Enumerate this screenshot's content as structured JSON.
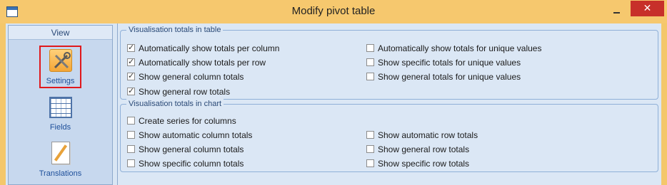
{
  "window": {
    "title": "Modify pivot table",
    "close_glyph": "✕"
  },
  "sidebar": {
    "header": "View",
    "items": [
      {
        "label": "Settings",
        "icon": "settings-icon",
        "selected": true
      },
      {
        "label": "Fields",
        "icon": "fields-icon",
        "selected": false
      },
      {
        "label": "Translations",
        "icon": "translations-icon",
        "selected": false
      }
    ]
  },
  "table_group": {
    "legend": "Visualisation totals in table",
    "options": [
      {
        "label": "Automatically show totals per column",
        "checked": true
      },
      {
        "label": "Automatically show totals per row",
        "checked": true
      },
      {
        "label": "Show general column totals",
        "checked": true
      },
      {
        "label": "Show general row totals",
        "checked": true
      },
      {
        "label": "Automatically show totals for unique values",
        "checked": false
      },
      {
        "label": "Show specific totals for unique values",
        "checked": false
      },
      {
        "label": "Show general totals for unique values",
        "checked": false
      }
    ]
  },
  "chart_group": {
    "legend": "Visualisation totals in chart",
    "options": [
      {
        "label": "Create series for columns",
        "checked": false
      },
      {
        "label": "Show automatic column totals",
        "checked": false
      },
      {
        "label": "Show general column totals",
        "checked": false
      },
      {
        "label": "Show specific column totals",
        "checked": false
      },
      {
        "label": "Show automatic row totals",
        "checked": false
      },
      {
        "label": "Show general row totals",
        "checked": false
      },
      {
        "label": "Show specific row totals",
        "checked": false
      }
    ]
  }
}
